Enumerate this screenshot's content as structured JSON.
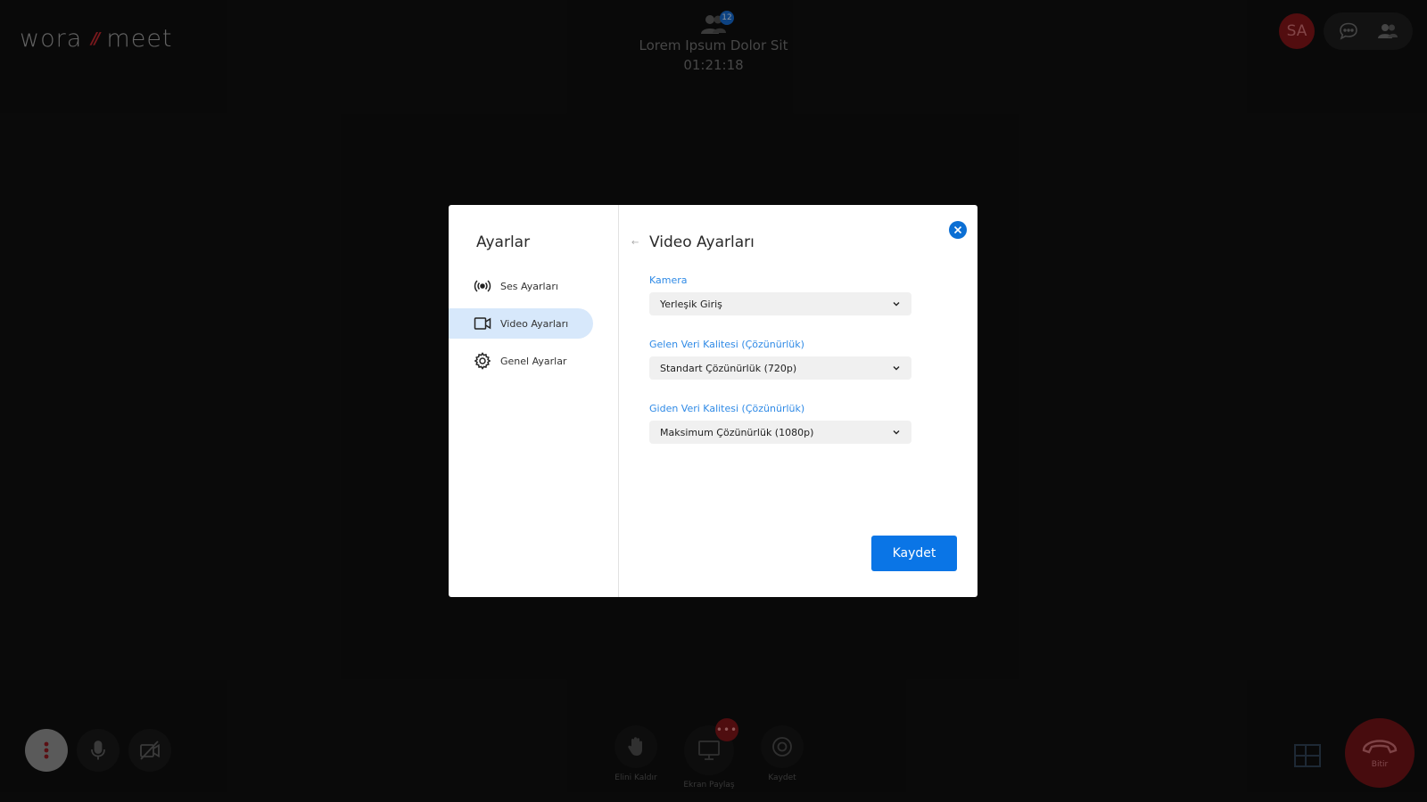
{
  "app": {
    "logo_left": "wora",
    "logo_sep": "//",
    "logo_right": "meet"
  },
  "meeting": {
    "title": "Lorem Ipsum Dolor Sit",
    "time": "01:21:18",
    "participant_count": "12"
  },
  "header": {
    "avatar_initials": "SA",
    "chat_icon": "chat-icon",
    "participants_icon": "participants-icon"
  },
  "bottom": {
    "raise_hand_label": "Elini Kaldır",
    "screen_share_label": "Ekran Paylaş",
    "screen_share_badge": "•••",
    "record_label": "Kaydet",
    "end_label": "Bitir"
  },
  "settings": {
    "sidebar_title": "Ayarlar",
    "items": [
      {
        "label": "Ses Ayarları",
        "icon": "audio-broadcast-icon"
      },
      {
        "label": "Video Ayarları",
        "icon": "video-camera-icon",
        "active": true
      },
      {
        "label": "Genel Ayarlar",
        "icon": "gear-icon"
      }
    ],
    "content_title": "Video Ayarları",
    "back_arrow": "←",
    "fields": [
      {
        "label": "Kamera",
        "value": "Yerleşik Giriş"
      },
      {
        "label": "Gelen Veri Kalitesi (Çözünürlük)",
        "value": "Standart Çözünürlük (720p)"
      },
      {
        "label": "Giden Veri Kalitesi (Çözünürlük)",
        "value": "Maksimum Çözünürlük (1080p)"
      }
    ],
    "save_label": "Kaydet"
  },
  "colors": {
    "accent": "#0a75e6",
    "label_blue": "#2f8ae6",
    "active_item_bg": "#d7e8fb",
    "end_call": "#6e1316"
  }
}
